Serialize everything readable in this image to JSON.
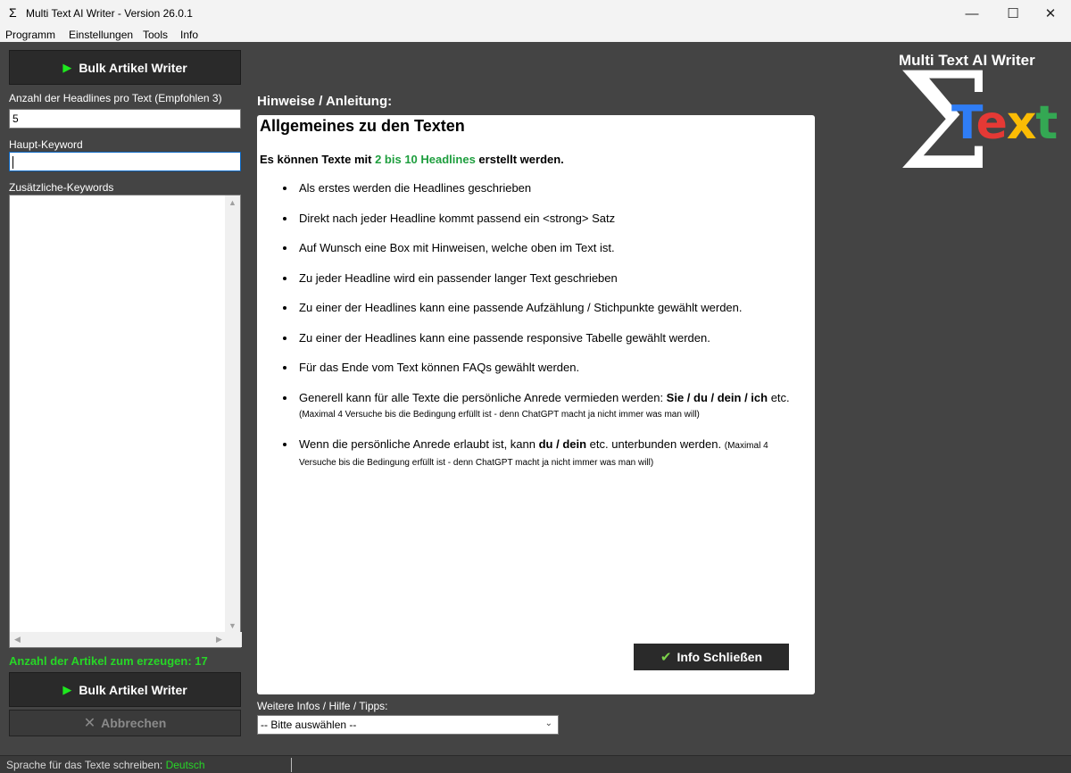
{
  "window": {
    "title": "Multi Text AI Writer - Version 26.0.1",
    "icon": "Σ",
    "controls": {
      "minimize": "—",
      "maximize": "☐",
      "close": "✕"
    }
  },
  "menu": [
    "Programm",
    "Einstellungen",
    "Tools",
    "Info"
  ],
  "left": {
    "top_button_label": "Bulk Artikel Writer",
    "headline_count_label": "Anzahl der Headlines pro Text (Empfohlen 3)",
    "headline_count_value": "5",
    "main_keyword_label": "Haupt-Keyword",
    "main_keyword_value": "",
    "extra_keywords_label": "Zusätzliche-Keywords",
    "extra_keywords_value": "",
    "article_count_label": "Anzahl der Artikel zum erzeugen:",
    "article_count_value": "17",
    "bottom_button_label": "Bulk Artikel Writer",
    "abort_button_label": "Abbrechen"
  },
  "hints": {
    "section_title": "Hinweise / Anleitung:",
    "panel_heading": "Allgemeines zu den Texten",
    "intro_prefix": "Es können Texte mit ",
    "intro_highlight": "2 bis 10 Headlines",
    "intro_suffix": " erstellt werden.",
    "bullets": [
      "Als erstes werden die Headlines geschrieben",
      "Direkt nach jeder Headline kommt passend ein <strong> Satz",
      "Auf Wunsch eine Box mit Hinweisen, welche oben im Text ist.",
      "Zu jeder Headline wird ein passender langer Text geschrieben",
      "Zu einer der Headlines kann eine passende Aufzählung / Stichpunkte gewählt werden.",
      "Zu einer der Headlines kann eine passende responsive Tabelle gewählt werden.",
      "Für das Ende vom Text können FAQs gewählt werden."
    ],
    "bullet8_text": "Generell kann für alle Texte die persönliche Anrede vermieden werden: ",
    "bullet8_bold": "Sie / du / dein / ich",
    "bullet8_after": " etc. ",
    "bullet8_small": "(Maximal 4 Versuche bis die Bedingung erfüllt ist - denn ChatGPT macht ja nicht immer was man will)",
    "bullet9_text": "Wenn die persönliche Anrede erlaubt ist, kann ",
    "bullet9_bold": "du / dein",
    "bullet9_after": " etc. unterbunden werden. ",
    "bullet9_small": "(Maximal 4 Versuche bis die Bedingung erfüllt ist - denn ChatGPT macht ja nicht immer was man will)",
    "close_button_label": "Info Schließen"
  },
  "more_info": {
    "label": "Weitere Infos / Hilfe / Tipps:",
    "selected": "-- Bitte auswählen --"
  },
  "logo": {
    "caption": "Multi Text AI Writer",
    "sigma": "Σ",
    "letters": [
      {
        "ch": "T",
        "color": "#2f7df6"
      },
      {
        "ch": "e",
        "color": "#e53935"
      },
      {
        "ch": "x",
        "color": "#fbbc05"
      },
      {
        "ch": "t",
        "color": "#34a853"
      }
    ]
  },
  "status": {
    "label": "Sprache für das Texte schreiben:",
    "value": "Deutsch"
  },
  "colors": {
    "accent_green": "#27d627",
    "highlight_green": "#1e9e3e",
    "background": "#444444"
  }
}
